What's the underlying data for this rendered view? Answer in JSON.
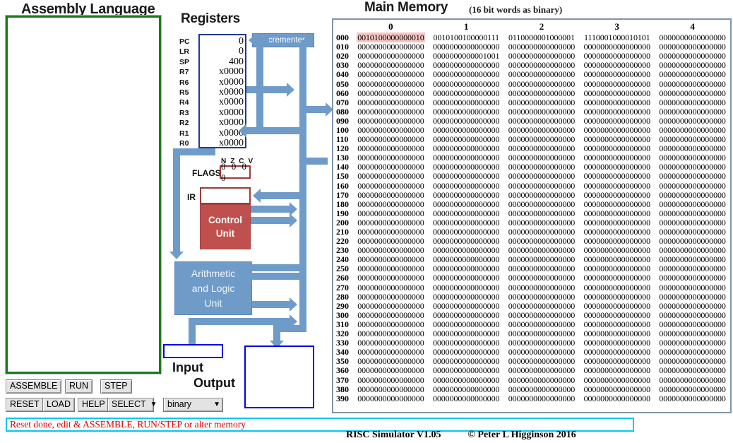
{
  "titles": {
    "assembly": "Assembly Language",
    "registers": "Registers",
    "main_memory": "Main Memory",
    "main_memory_sub": "(16 bit words as binary)"
  },
  "assembly": {
    "value": "",
    "border_color": "#1a7a1a"
  },
  "buttons": {
    "assemble": "ASSEMBLE",
    "run": "RUN",
    "step": "STEP",
    "reset": "RESET",
    "load": "LOAD",
    "help": "HELP",
    "select": "SELECT",
    "format": "binary"
  },
  "status": {
    "message": "Reset done, edit & ASSEMBLE, RUN/STEP or alter memory",
    "text_color": "#e00000",
    "border_color": "#00c8f0"
  },
  "registers": {
    "names": [
      "PC",
      "LR",
      "SP",
      "R7",
      "R6",
      "R5",
      "R4",
      "R3",
      "R2",
      "R1",
      "R0"
    ],
    "values": [
      "0",
      "0",
      "400",
      "x0000",
      "x0000",
      "x0000",
      "x0000",
      "x0000",
      "x0000",
      "x0000",
      "x0000"
    ]
  },
  "flags": {
    "header": "N Z C V",
    "label": "FLAGS",
    "value": "0 0 0 0"
  },
  "ir": {
    "label": "IR",
    "value": ""
  },
  "blocks": {
    "control_unit_line1": "Control",
    "control_unit_line2": "Unit",
    "alu_line1": "Arithmetic",
    "alu_line2": "and Logic",
    "alu_line3": "Unit",
    "incrementer": "Incrementer",
    "input_label": "Input",
    "output_label": "Output",
    "input_value": "",
    "output_value": ""
  },
  "colors": {
    "bus": "#6f9bc9",
    "control_unit": "#c0504d",
    "alu": "#6f9bc9",
    "highlight": "#f7c4c4",
    "input_border": "#0000e6"
  },
  "memory": {
    "columns": [
      "0",
      "1",
      "2",
      "3",
      "4"
    ],
    "highlight": {
      "row": 0,
      "col": 0
    },
    "rows": [
      {
        "addr": "000",
        "cells": [
          "0010100000000010",
          "0010100100000111",
          "0110000001000001",
          "1110001000010101",
          "0000000000000000"
        ]
      },
      {
        "addr": "010",
        "cells": [
          "0000000000000000",
          "0000000000000000",
          "0000000000000000",
          "0000000000000000",
          "0000000000000000"
        ]
      },
      {
        "addr": "020",
        "cells": [
          "0000000000000000",
          "0000000000001001",
          "0000000000000000",
          "0000000000000000",
          "0000000000000000"
        ]
      },
      {
        "addr": "030",
        "cells": [
          "0000000000000000",
          "0000000000000000",
          "0000000000000000",
          "0000000000000000",
          "0000000000000000"
        ]
      },
      {
        "addr": "040",
        "cells": [
          "0000000000000000",
          "0000000000000000",
          "0000000000000000",
          "0000000000000000",
          "0000000000000000"
        ]
      },
      {
        "addr": "050",
        "cells": [
          "0000000000000000",
          "0000000000000000",
          "0000000000000000",
          "0000000000000000",
          "0000000000000000"
        ]
      },
      {
        "addr": "060",
        "cells": [
          "0000000000000000",
          "0000000000000000",
          "0000000000000000",
          "0000000000000000",
          "0000000000000000"
        ]
      },
      {
        "addr": "070",
        "cells": [
          "0000000000000000",
          "0000000000000000",
          "0000000000000000",
          "0000000000000000",
          "0000000000000000"
        ]
      },
      {
        "addr": "080",
        "cells": [
          "0000000000000000",
          "0000000000000000",
          "0000000000000000",
          "0000000000000000",
          "0000000000000000"
        ]
      },
      {
        "addr": "090",
        "cells": [
          "0000000000000000",
          "0000000000000000",
          "0000000000000000",
          "0000000000000000",
          "0000000000000000"
        ]
      },
      {
        "addr": "100",
        "cells": [
          "0000000000000000",
          "0000000000000000",
          "0000000000000000",
          "0000000000000000",
          "0000000000000000"
        ]
      },
      {
        "addr": "110",
        "cells": [
          "0000000000000000",
          "0000000000000000",
          "0000000000000000",
          "0000000000000000",
          "0000000000000000"
        ]
      },
      {
        "addr": "120",
        "cells": [
          "0000000000000000",
          "0000000000000000",
          "0000000000000000",
          "0000000000000000",
          "0000000000000000"
        ]
      },
      {
        "addr": "130",
        "cells": [
          "0000000000000000",
          "0000000000000000",
          "0000000000000000",
          "0000000000000000",
          "0000000000000000"
        ]
      },
      {
        "addr": "140",
        "cells": [
          "0000000000000000",
          "0000000000000000",
          "0000000000000000",
          "0000000000000000",
          "0000000000000000"
        ]
      },
      {
        "addr": "150",
        "cells": [
          "0000000000000000",
          "0000000000000000",
          "0000000000000000",
          "0000000000000000",
          "0000000000000000"
        ]
      },
      {
        "addr": "160",
        "cells": [
          "0000000000000000",
          "0000000000000000",
          "0000000000000000",
          "0000000000000000",
          "0000000000000000"
        ]
      },
      {
        "addr": "170",
        "cells": [
          "0000000000000000",
          "0000000000000000",
          "0000000000000000",
          "0000000000000000",
          "0000000000000000"
        ]
      },
      {
        "addr": "180",
        "cells": [
          "0000000000000000",
          "0000000000000000",
          "0000000000000000",
          "0000000000000000",
          "0000000000000000"
        ]
      },
      {
        "addr": "190",
        "cells": [
          "0000000000000000",
          "0000000000000000",
          "0000000000000000",
          "0000000000000000",
          "0000000000000000"
        ]
      },
      {
        "addr": "200",
        "cells": [
          "0000000000000000",
          "0000000000000000",
          "0000000000000000",
          "0000000000000000",
          "0000000000000000"
        ]
      },
      {
        "addr": "210",
        "cells": [
          "0000000000000000",
          "0000000000000000",
          "0000000000000000",
          "0000000000000000",
          "0000000000000000"
        ]
      },
      {
        "addr": "220",
        "cells": [
          "0000000000000000",
          "0000000000000000",
          "0000000000000000",
          "0000000000000000",
          "0000000000000000"
        ]
      },
      {
        "addr": "230",
        "cells": [
          "0000000000000000",
          "0000000000000000",
          "0000000000000000",
          "0000000000000000",
          "0000000000000000"
        ]
      },
      {
        "addr": "240",
        "cells": [
          "0000000000000000",
          "0000000000000000",
          "0000000000000000",
          "0000000000000000",
          "0000000000000000"
        ]
      },
      {
        "addr": "250",
        "cells": [
          "0000000000000000",
          "0000000000000000",
          "0000000000000000",
          "0000000000000000",
          "0000000000000000"
        ]
      },
      {
        "addr": "260",
        "cells": [
          "0000000000000000",
          "0000000000000000",
          "0000000000000000",
          "0000000000000000",
          "0000000000000000"
        ]
      },
      {
        "addr": "270",
        "cells": [
          "0000000000000000",
          "0000000000000000",
          "0000000000000000",
          "0000000000000000",
          "0000000000000000"
        ]
      },
      {
        "addr": "280",
        "cells": [
          "0000000000000000",
          "0000000000000000",
          "0000000000000000",
          "0000000000000000",
          "0000000000000000"
        ]
      },
      {
        "addr": "290",
        "cells": [
          "0000000000000000",
          "0000000000000000",
          "0000000000000000",
          "0000000000000000",
          "0000000000000000"
        ]
      },
      {
        "addr": "300",
        "cells": [
          "0000000000000000",
          "0000000000000000",
          "0000000000000000",
          "0000000000000000",
          "0000000000000000"
        ]
      },
      {
        "addr": "310",
        "cells": [
          "0000000000000000",
          "0000000000000000",
          "0000000000000000",
          "0000000000000000",
          "0000000000000000"
        ]
      },
      {
        "addr": "320",
        "cells": [
          "0000000000000000",
          "0000000000000000",
          "0000000000000000",
          "0000000000000000",
          "0000000000000000"
        ]
      },
      {
        "addr": "330",
        "cells": [
          "0000000000000000",
          "0000000000000000",
          "0000000000000000",
          "0000000000000000",
          "0000000000000000"
        ]
      },
      {
        "addr": "340",
        "cells": [
          "0000000000000000",
          "0000000000000000",
          "0000000000000000",
          "0000000000000000",
          "0000000000000000"
        ]
      },
      {
        "addr": "350",
        "cells": [
          "0000000000000000",
          "0000000000000000",
          "0000000000000000",
          "0000000000000000",
          "0000000000000000"
        ]
      },
      {
        "addr": "360",
        "cells": [
          "0000000000000000",
          "0000000000000000",
          "0000000000000000",
          "0000000000000000",
          "0000000000000000"
        ]
      },
      {
        "addr": "370",
        "cells": [
          "0000000000000000",
          "0000000000000000",
          "0000000000000000",
          "0000000000000000",
          "0000000000000000"
        ]
      },
      {
        "addr": "380",
        "cells": [
          "0000000000000000",
          "0000000000000000",
          "0000000000000000",
          "0000000000000000",
          "0000000000000000"
        ]
      },
      {
        "addr": "390",
        "cells": [
          "0000000000000000",
          "0000000000000000",
          "0000000000000000",
          "0000000000000000",
          "0000000000000000"
        ]
      }
    ]
  },
  "footer": {
    "product": "RISC Simulator V1.05",
    "copyright": "© Peter L Higginson 2016"
  }
}
